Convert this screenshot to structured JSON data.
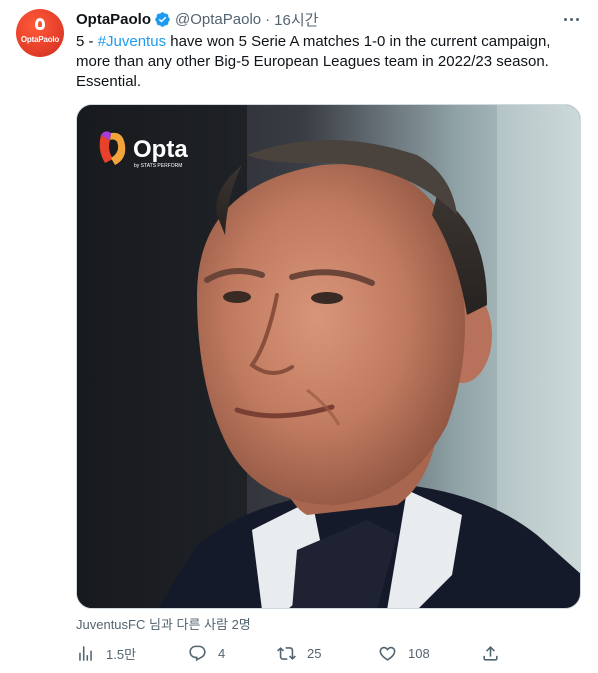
{
  "author": {
    "name": "OptaPaolo",
    "handle": "@OptaPaolo",
    "separator": "·",
    "time": "16시간",
    "avatar_text": "OptaPaolo"
  },
  "tweet": {
    "text_prefix": "5 - ",
    "hashtag": "#Juventus",
    "text_line1_rest": " have won 5 Serie A matches 1-0 in the current campaign,",
    "text_line2": "more than any other Big-5 European Leagues team in 2022/23 season.",
    "text_line3": "Essential."
  },
  "media": {
    "logo_name": "Opta",
    "logo_sub": "by STATS PERFORM"
  },
  "tagged": "JuventusFC 님과 다른 사람 2명",
  "actions": {
    "views": "1.5만",
    "replies": "4",
    "retweets": "25",
    "likes": "108"
  },
  "colors": {
    "accent": "#1d9bf0",
    "secondary_text": "#536471",
    "avatar_bg": "#e8412b"
  },
  "icons": [
    "verified-badge-icon",
    "more-icon",
    "views-icon",
    "reply-icon",
    "retweet-icon",
    "like-icon",
    "share-icon"
  ]
}
